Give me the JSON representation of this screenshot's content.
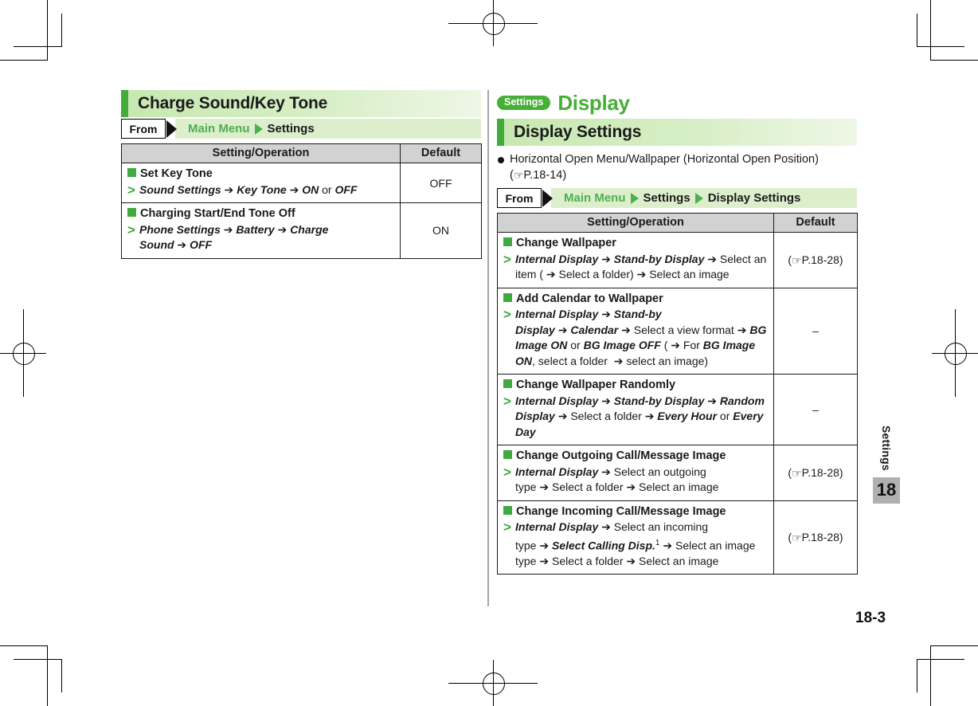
{
  "page": {
    "number": "18-3",
    "side_tab": {
      "label": "Settings",
      "chapter": "18"
    }
  },
  "left_column": {
    "section_title": "Charge Sound/Key Tone",
    "frombar": {
      "from_label": "From",
      "path": [
        "Main Menu",
        "Settings"
      ]
    },
    "table": {
      "headers": [
        "Setting/Operation",
        "Default"
      ],
      "rows": [
        {
          "title": "Set Key Tone",
          "steps": [
            {
              "t": "Sound Settings",
              "s": "b"
            },
            {
              "t": "→",
              "s": "a"
            },
            {
              "t": "Key Tone",
              "s": "b"
            },
            {
              "t": "→",
              "s": "a"
            },
            {
              "t": "ON",
              "s": "b"
            },
            {
              "t": " or ",
              "s": "p"
            },
            {
              "t": "OFF",
              "s": "b"
            }
          ],
          "default": "OFF"
        },
        {
          "title": "Charging Start/End Tone Off",
          "steps": [
            {
              "t": "Phone Settings",
              "s": "b"
            },
            {
              "t": "→",
              "s": "a"
            },
            {
              "t": "Battery",
              "s": "b"
            },
            {
              "t": "→",
              "s": "a"
            },
            {
              "t": "Charge Sound",
              "s": "b"
            },
            {
              "t": "→",
              "s": "a"
            },
            {
              "t": "OFF",
              "s": "b"
            }
          ],
          "default": "ON"
        }
      ]
    }
  },
  "right_column": {
    "chapter_badge": "Settings",
    "chapter_name": "Display",
    "section_title": "Display Settings",
    "note": {
      "text": "Horizontal Open Menu/Wallpaper (Horizontal Open Position)",
      "ref_open": "(",
      "ref_icon": "hand-pointing-icon",
      "ref_page": "P.18-14",
      "ref_close": ")"
    },
    "frombar": {
      "from_label": "From",
      "path": [
        "Main Menu",
        "Settings",
        "Display Settings"
      ]
    },
    "table": {
      "headers": [
        "Setting/Operation",
        "Default"
      ],
      "rows": [
        {
          "title": "Change Wallpaper",
          "steps": [
            {
              "t": "Internal Display",
              "s": "b"
            },
            {
              "t": "→",
              "s": "a"
            },
            {
              "t": "Stand-by Display",
              "s": "b"
            },
            {
              "t": "→",
              "s": "a"
            },
            {
              "t": "Select an item (",
              "s": "p"
            },
            {
              "t": "→",
              "s": "a"
            },
            {
              "t": "Select a folder)",
              "s": "p"
            },
            {
              "t": "→",
              "s": "a"
            },
            {
              "t": "Select an image",
              "s": "p"
            }
          ],
          "default": "(☞P.18-28)",
          "default_ref": "P.18-28"
        },
        {
          "title": "Add Calendar to Wallpaper",
          "steps": [
            {
              "t": "Internal Display",
              "s": "b"
            },
            {
              "t": "→",
              "s": "a"
            },
            {
              "t": "Stand-by Display",
              "s": "b"
            },
            {
              "t": "→",
              "s": "a"
            },
            {
              "t": "Calendar",
              "s": "b"
            },
            {
              "t": "→",
              "s": "a"
            },
            {
              "t": "Select a view format",
              "s": "p"
            },
            {
              "t": "→",
              "s": "a"
            },
            {
              "t": "BG Image ON",
              "s": "b"
            },
            {
              "t": " or ",
              "s": "p"
            },
            {
              "t": "BG Image OFF",
              "s": "b"
            },
            {
              "t": " (",
              "s": "p"
            },
            {
              "t": "→",
              "s": "a"
            },
            {
              "t": "For ",
              "s": "p"
            },
            {
              "t": "BG Image ON",
              "s": "b"
            },
            {
              "t": ", select a folder ",
              "s": "p"
            },
            {
              "t": "→",
              "s": "a"
            },
            {
              "t": "select an image)",
              "s": "p"
            }
          ],
          "default": "–"
        },
        {
          "title": "Change Wallpaper Randomly",
          "steps": [
            {
              "t": "Internal Display",
              "s": "b"
            },
            {
              "t": "→",
              "s": "a"
            },
            {
              "t": "Stand-by Display",
              "s": "b"
            },
            {
              "t": "→",
              "s": "a"
            },
            {
              "t": "Random Display",
              "s": "b"
            },
            {
              "t": "→",
              "s": "a"
            },
            {
              "t": "Select a folder",
              "s": "p"
            },
            {
              "t": "→",
              "s": "a"
            },
            {
              "t": "Every Hour",
              "s": "b"
            },
            {
              "t": " or ",
              "s": "p"
            },
            {
              "t": "Every Day",
              "s": "b"
            }
          ],
          "default": "–"
        },
        {
          "title": "Change Outgoing Call/Message Image",
          "steps": [
            {
              "t": "Internal Display",
              "s": "b"
            },
            {
              "t": "→",
              "s": "a"
            },
            {
              "t": "Select an outgoing type",
              "s": "p"
            },
            {
              "t": "→",
              "s": "a"
            },
            {
              "t": "Select a folder",
              "s": "p"
            },
            {
              "t": "→",
              "s": "a"
            },
            {
              "t": "Select an image",
              "s": "p"
            }
          ],
          "default": "(☞P.18-28)",
          "default_ref": "P.18-28"
        },
        {
          "title": "Change Incoming Call/Message Image",
          "steps": [
            {
              "t": "Internal Display",
              "s": "b"
            },
            {
              "t": "→",
              "s": "a"
            },
            {
              "t": "Select an incoming type",
              "s": "p"
            },
            {
              "t": "→",
              "s": "a"
            },
            {
              "t": "Select Calling Disp.",
              "s": "b"
            },
            {
              "t": "1",
              "s": "sup"
            },
            {
              "t": "→",
              "s": "a"
            },
            {
              "t": "Select an image type",
              "s": "p"
            },
            {
              "t": "→",
              "s": "a"
            },
            {
              "t": "Select a folder",
              "s": "p"
            },
            {
              "t": "→",
              "s": "a"
            },
            {
              "t": "Select an image",
              "s": "p"
            }
          ],
          "default": "(☞P.18-28)",
          "default_ref": "P.18-28"
        }
      ]
    }
  },
  "colors": {
    "accent_green": "#45b035",
    "bar_green": "#41ab3c",
    "title_gradient_start": "#c7e8b0",
    "frombar_green": "#ddeecd",
    "table_header_gray": "#d2d2d2",
    "side_tab_gray": "#b0b0b0"
  }
}
